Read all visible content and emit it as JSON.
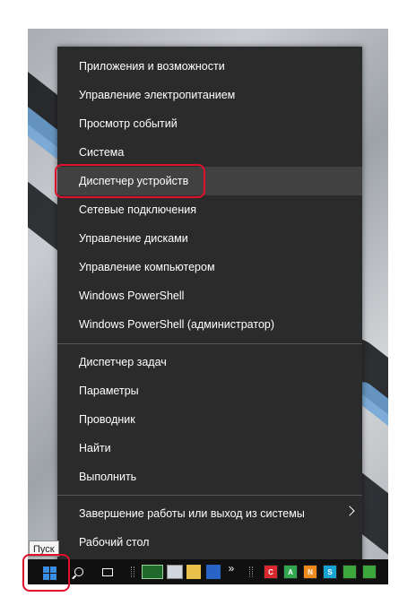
{
  "menu": {
    "items": [
      {
        "label": "Приложения и возможности"
      },
      {
        "label": "Управление электропитанием"
      },
      {
        "label": "Просмотр событий"
      },
      {
        "label": "Система"
      },
      {
        "label": "Диспетчер устройств"
      },
      {
        "label": "Сетевые подключения"
      },
      {
        "label": "Управление дисками"
      },
      {
        "label": "Управление компьютером"
      },
      {
        "label": "Windows PowerShell"
      },
      {
        "label": "Windows PowerShell (администратор)"
      },
      {
        "label": "Диспетчер задач"
      },
      {
        "label": "Параметры"
      },
      {
        "label": "Проводник"
      },
      {
        "label": "Найти"
      },
      {
        "label": "Выполнить"
      },
      {
        "label": "Завершение работы или выход из системы"
      },
      {
        "label": "Рабочий стол"
      }
    ],
    "highlighted_item": "Диспетчер устройств"
  },
  "taskbar": {
    "start_tooltip": "Пуск",
    "overflow_label": "»",
    "tray_icons": [
      {
        "name": "red-app-icon",
        "color": "#d9282f"
      },
      {
        "name": "green-app-icon",
        "color": "#2fa84f"
      },
      {
        "name": "orange-app-icon",
        "color": "#f08a1c"
      },
      {
        "name": "cyan-app-icon",
        "color": "#18a3d4"
      },
      {
        "name": "green-app-icon-2",
        "color": "#3aa83c"
      },
      {
        "name": "green-app-icon-3",
        "color": "#3aa83c"
      }
    ],
    "tray_letters": [
      "C",
      "A",
      "N",
      "S",
      "",
      ""
    ]
  },
  "colors": {
    "menu_bg": "#2b2b2b",
    "menu_hover": "#414141",
    "highlight_border": "#e0102a",
    "windows_blue": "#3a8de0"
  }
}
